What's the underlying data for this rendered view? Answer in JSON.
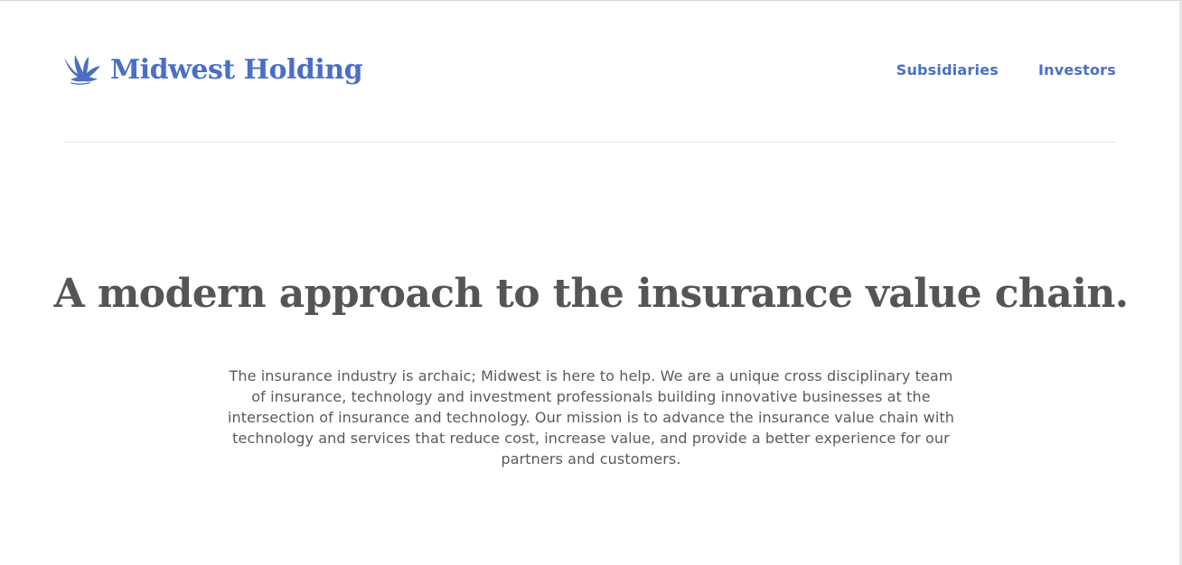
{
  "header": {
    "logo": {
      "icon": "bird-logo-icon",
      "text": "Midwest Holding"
    },
    "nav": [
      {
        "label": "Subsidiaries"
      },
      {
        "label": "Investors"
      }
    ]
  },
  "hero": {
    "title": "A modern approach to the insurance value chain.",
    "text": "The insurance industry is archaic; Midwest is here to help. We are a unique cross disciplinary team of insurance, technology and investment professionals building innovative businesses at the intersection of insurance and technology. Our mission is to advance the insurance value chain with technology and services that reduce cost, increase value, and provide a better experience for our partners and customers."
  },
  "colors": {
    "brand": "#4a6fc4",
    "text": "#555555",
    "divider": "#e3e3e3",
    "background": "#ffffff"
  }
}
